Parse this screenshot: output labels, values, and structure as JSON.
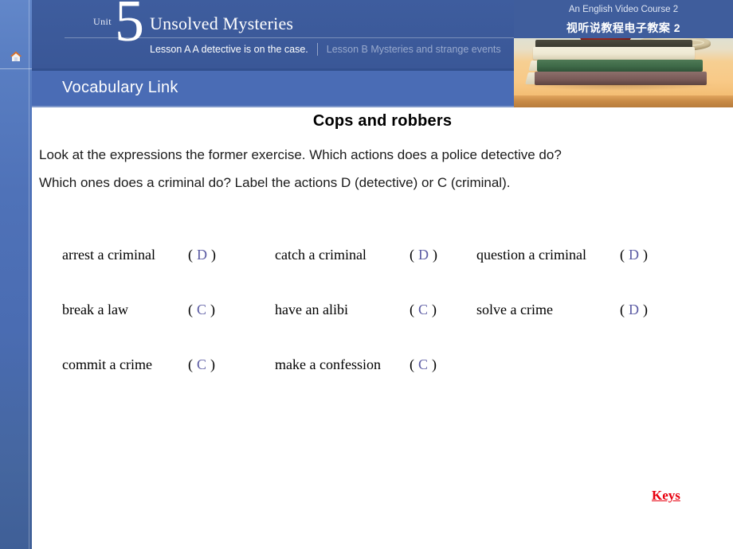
{
  "sidebar": {
    "home_icon": "home-icon"
  },
  "header": {
    "unit_label": "Unit",
    "unit_number": "5",
    "course_title": "Unsolved Mysteries",
    "lesson_a": "Lesson A  A detective is on the case.",
    "lesson_b": "Lesson B Mysteries and strange events",
    "section_title": "Vocabulary Link",
    "colors": {
      "header_blue": "#3b5a9b",
      "section_bar_blue": "#4a6cb5",
      "sidebar_blue": "#4f72b8"
    }
  },
  "media": {
    "title_en": "An English Video Course 2",
    "title_zh": "视听说教程电子教案 2",
    "image_alt": "stacked-books-photo"
  },
  "main": {
    "exercise_title": "Cops and robbers",
    "instruction_line_1": "Look at the expressions the former exercise. Which actions does a police detective do?",
    "instruction_line_2": "Which ones does a criminal do? Label the actions D (detective) or C (criminal).",
    "answer_color": "#5b5ba3",
    "rows": [
      [
        {
          "phrase": "arrest a criminal",
          "open": "(",
          "answer": "D",
          "close": ")"
        },
        {
          "phrase": "catch a criminal",
          "open": "(",
          "answer": "D",
          "close": ")"
        },
        {
          "phrase": "question a criminal",
          "open": "(",
          "answer": "D",
          "close": ")"
        }
      ],
      [
        {
          "phrase": "break a law",
          "open": "(",
          "answer": "C",
          "close": ")"
        },
        {
          "phrase": "have an alibi",
          "open": "(",
          "answer": "C",
          "close": ")"
        },
        {
          "phrase": "solve a crime",
          "open": "(",
          "answer": "D",
          "close": ")"
        }
      ],
      [
        {
          "phrase": "commit a crime",
          "open": "(",
          "answer": "C",
          "close": ")"
        },
        {
          "phrase": "make a confession",
          "open": "(",
          "answer": "C",
          "close": ")"
        },
        {
          "phrase": "",
          "open": "",
          "answer": "",
          "close": ""
        }
      ]
    ],
    "keys_link": "Keys",
    "keys_color": "#e8000f"
  }
}
